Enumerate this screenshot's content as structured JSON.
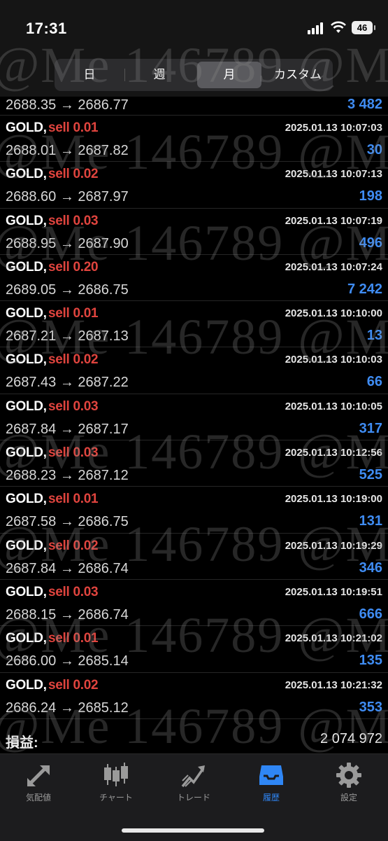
{
  "status_bar": {
    "time": "17:31",
    "battery": "46"
  },
  "period_tabs": [
    {
      "label": "日",
      "active": false
    },
    {
      "label": "週",
      "active": false
    },
    {
      "label": "月",
      "active": true
    },
    {
      "label": "カスタム",
      "active": false
    }
  ],
  "top_partial": {
    "prices": "2688.35 → 2686.77",
    "profit": "3 482"
  },
  "trades": [
    {
      "symbol": "GOLD,",
      "side": "sell 0.01",
      "datetime": "2025.01.13 10:07:03",
      "prices": "2688.01 → 2687.82",
      "profit": "30"
    },
    {
      "symbol": "GOLD,",
      "side": "sell 0.02",
      "datetime": "2025.01.13 10:07:13",
      "prices": "2688.60 → 2687.97",
      "profit": "198"
    },
    {
      "symbol": "GOLD,",
      "side": "sell 0.03",
      "datetime": "2025.01.13 10:07:19",
      "prices": "2688.95 → 2687.90",
      "profit": "496"
    },
    {
      "symbol": "GOLD,",
      "side": "sell 0.20",
      "datetime": "2025.01.13 10:07:24",
      "prices": "2689.05 → 2686.75",
      "profit": "7 242"
    },
    {
      "symbol": "GOLD,",
      "side": "sell 0.01",
      "datetime": "2025.01.13 10:10:00",
      "prices": "2687.21 → 2687.13",
      "profit": "13"
    },
    {
      "symbol": "GOLD,",
      "side": "sell 0.02",
      "datetime": "2025.01.13 10:10:03",
      "prices": "2687.43 → 2687.22",
      "profit": "66"
    },
    {
      "symbol": "GOLD,",
      "side": "sell 0.03",
      "datetime": "2025.01.13 10:10:05",
      "prices": "2687.84 → 2687.17",
      "profit": "317"
    },
    {
      "symbol": "GOLD,",
      "side": "sell 0.03",
      "datetime": "2025.01.13 10:12:56",
      "prices": "2688.23 → 2687.12",
      "profit": "525"
    },
    {
      "symbol": "GOLD,",
      "side": "sell 0.01",
      "datetime": "2025.01.13 10:19:00",
      "prices": "2687.58 → 2686.75",
      "profit": "131"
    },
    {
      "symbol": "GOLD,",
      "side": "sell 0.02",
      "datetime": "2025.01.13 10:19:29",
      "prices": "2687.84 → 2686.74",
      "profit": "346"
    },
    {
      "symbol": "GOLD,",
      "side": "sell 0.03",
      "datetime": "2025.01.13 10:19:51",
      "prices": "2688.15 → 2686.74",
      "profit": "666"
    },
    {
      "symbol": "GOLD,",
      "side": "sell 0.01",
      "datetime": "2025.01.13 10:21:02",
      "prices": "2686.00 → 2685.14",
      "profit": "135"
    },
    {
      "symbol": "GOLD,",
      "side": "sell 0.02",
      "datetime": "2025.01.13 10:21:32",
      "prices": "2686.24 → 2685.12",
      "profit": "353"
    }
  ],
  "totals": {
    "label": "損益:",
    "value": "2 074 972"
  },
  "nav": [
    {
      "label": "気配値",
      "icon": "quotes-arrows-icon",
      "active": false
    },
    {
      "label": "チャート",
      "icon": "candlestick-chart-icon",
      "active": false
    },
    {
      "label": "トレード",
      "icon": "trade-chart-icon",
      "active": false
    },
    {
      "label": "履歴",
      "icon": "history-inbox-icon",
      "active": true
    },
    {
      "label": "設定",
      "icon": "gear-icon",
      "active": false
    }
  ],
  "watermark": "@Me 146789 @M",
  "colors": {
    "sell": "#e0443e",
    "profit": "#3f8cf3",
    "active_tab": "#2f86f5"
  }
}
